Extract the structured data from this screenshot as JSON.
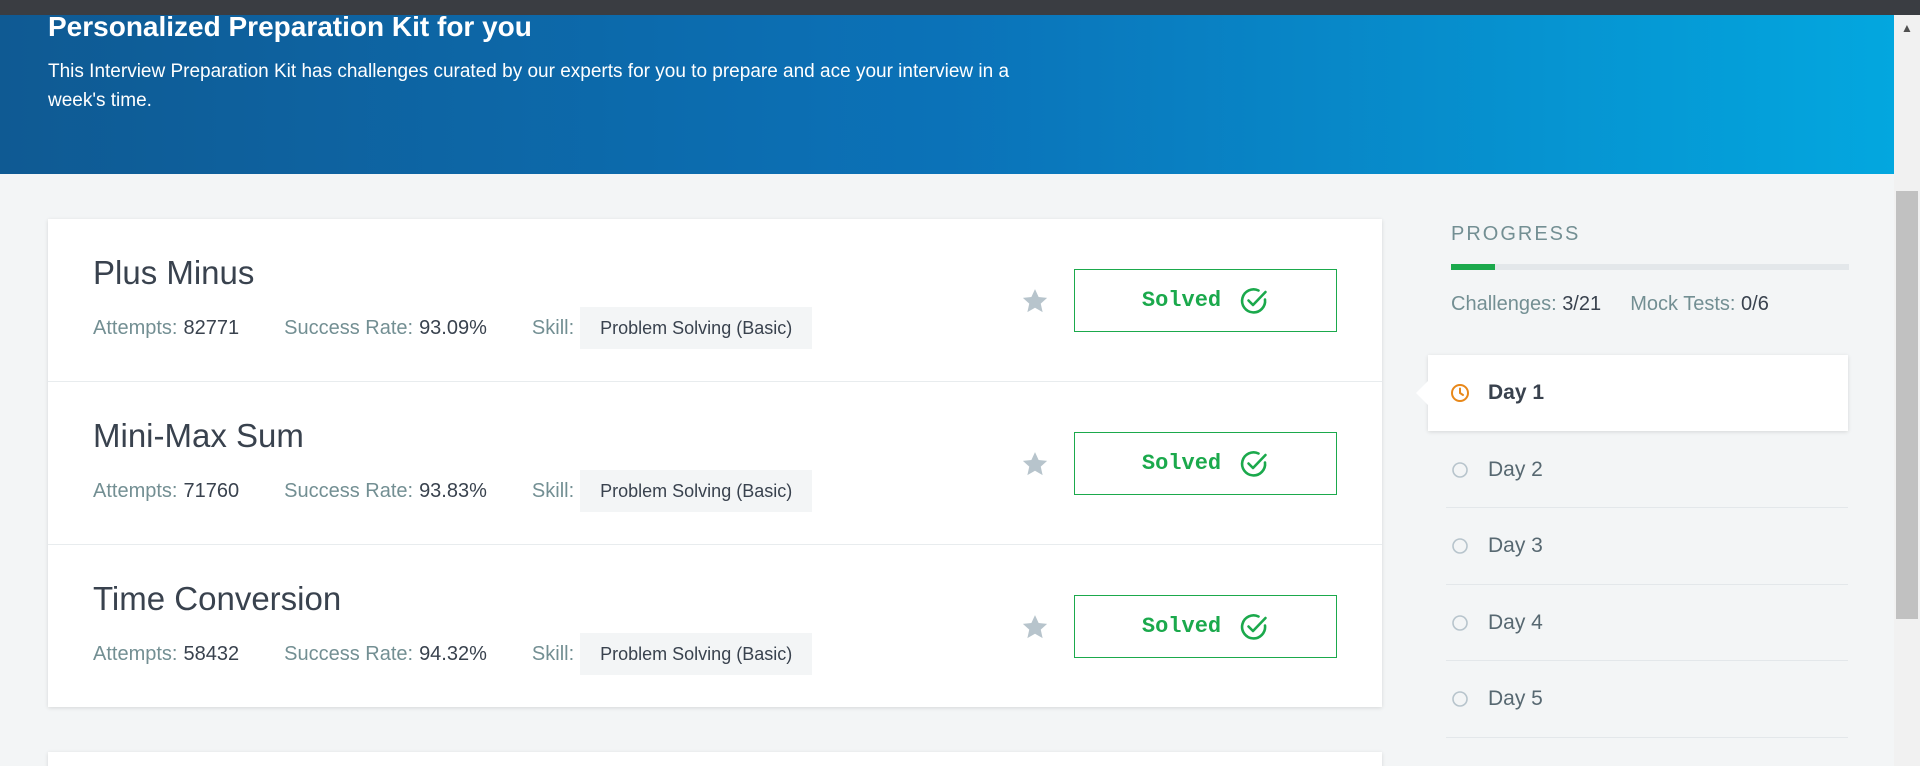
{
  "hero": {
    "title": "Personalized Preparation Kit for you",
    "description": "This Interview Preparation Kit has challenges curated by our experts for you to prepare and ace your interview in a week's time."
  },
  "labels": {
    "attempts": "Attempts:",
    "success_rate": "Success Rate:",
    "skill": "Skill:",
    "solved": "Solved"
  },
  "challenges": [
    {
      "title": "Plus Minus",
      "attempts": "82771",
      "success_rate": "93.09%",
      "skill": "Problem Solving (Basic)",
      "status": "Solved"
    },
    {
      "title": "Mini-Max Sum",
      "attempts": "71760",
      "success_rate": "93.83%",
      "skill": "Problem Solving (Basic)",
      "status": "Solved"
    },
    {
      "title": "Time Conversion",
      "attempts": "58432",
      "success_rate": "94.32%",
      "skill": "Problem Solving (Basic)",
      "status": "Solved"
    }
  ],
  "progress": {
    "title": "PROGRESS",
    "fraction": 0.11,
    "challenges_label": "Challenges:",
    "challenges_value": "3/21",
    "mock_label": "Mock Tests:",
    "mock_value": "0/6"
  },
  "days": [
    {
      "label": "Day 1",
      "active": true
    },
    {
      "label": "Day 2",
      "active": false
    },
    {
      "label": "Day 3",
      "active": false
    },
    {
      "label": "Day 4",
      "active": false
    },
    {
      "label": "Day 5",
      "active": false
    }
  ],
  "colors": {
    "success": "#1ba94c",
    "accent_clock": "#e8881a",
    "star": "#b7c4cc"
  }
}
